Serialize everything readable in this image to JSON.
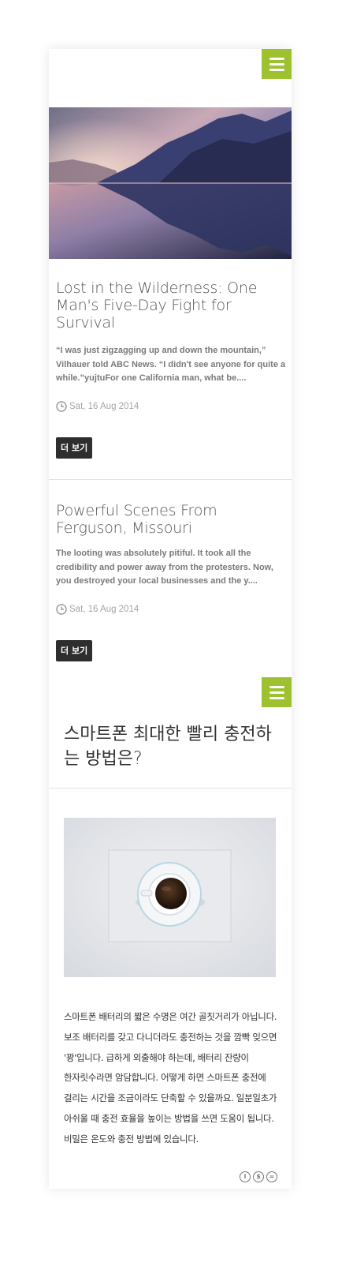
{
  "header": {
    "menu_icon": "hamburger-menu-icon",
    "accent_color": "#9dc12f"
  },
  "posts": [
    {
      "title": "Lost in the Wilderness: One Man's Five-Day Fight for Survival",
      "excerpt": "“I was just zigzagging up and down the mountain,” Vilhauer told ABC News. “I didn't see anyone for quite a while.”yujtuFor one California man, what be....",
      "date": "Sat, 16 Aug 2014",
      "more_label": "더 보기"
    },
    {
      "title": "Powerful Scenes From Ferguson, Missouri",
      "excerpt": "The looting was absolutely pitiful. It took all the credibility and power away from the protesters. Now, you destroyed your local businesses and the y....",
      "date": "Sat, 16 Aug 2014",
      "more_label": "더 보기"
    }
  ],
  "article": {
    "title": "스마트폰 최대한 빨리 충전하는 방법은?",
    "body": "스마트폰 배터리의 짧은 수명은 여간 골칫거리가 아닙니다. 보조 배터리를 갖고 다니더라도 충전하는 것을 깜빡 잊으면 '꽝'입니다. 급하게 외출해야 하는데, 배터리 잔량이 한자릿수라면 암담합니다. 어떻게 하면 스마트폰 충전에 걸리는 시간을 조금이라도 단축할 수 있을까요. 일분일초가 아쉬울 때 충전 효율을 높이는 방법을 쓰면 도움이 됩니다. 비밀은 온도와 충전 방법에 있습니다."
  },
  "license_icons": [
    "cc-by-icon",
    "cc-nc-icon",
    "cc-nd-icon"
  ]
}
